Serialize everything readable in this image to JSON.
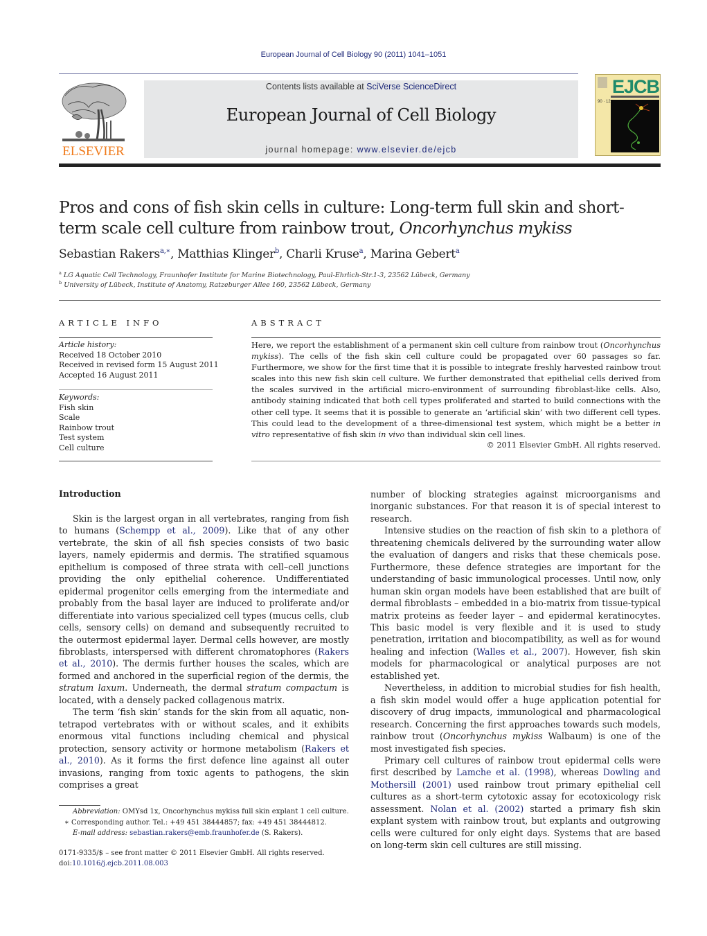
{
  "running_head": "European Journal of Cell Biology 90 (2011) 1041–1051",
  "masthead": {
    "publisher_logo_text": "ELSEVIER",
    "contents_prefix": "Contents lists available at ",
    "contents_link": "SciVerse ScienceDirect",
    "journal_title": "European Journal of Cell Biology",
    "homepage_prefix": "journal homepage: ",
    "homepage_link": "www.elsevier.de/ejcb",
    "cover_logo": "EJCB",
    "cover_volume": "90 · 12"
  },
  "colors": {
    "link": "#1f2a7a",
    "elsevier_orange": "#f07a1a",
    "masthead_bg": "#e6e7e8",
    "cover_bg": "#f4e7a8",
    "cover_logo": "#1f8a6a"
  },
  "article": {
    "title_part1": "Pros and cons of fish skin cells in culture: Long-term full skin and short-term scale cell culture from rainbow trout, ",
    "title_italic": "Oncorhynchus mykiss",
    "authors": [
      {
        "name": "Sebastian Rakers",
        "sup": "a,∗",
        "sep": ", "
      },
      {
        "name": "Matthias Klinger",
        "sup": "b",
        "sep": ", "
      },
      {
        "name": "Charli Kruse",
        "sup": "a",
        "sep": ", "
      },
      {
        "name": "Marina Gebert",
        "sup": "a",
        "sep": ""
      }
    ],
    "affiliations": [
      {
        "key": "a",
        "text": "LG Aquatic Cell Technology, Fraunhofer Institute for Marine Biotechnology, Paul-Ehrlich-Str.1-3, 23562 Lübeck, Germany"
      },
      {
        "key": "b",
        "text": "University of Lübeck, Institute of Anatomy, Ratzeburger Allee 160, 23562 Lübeck, Germany"
      }
    ]
  },
  "article_info": {
    "heading": "ARTICLE INFO",
    "history_label": "Article history:",
    "history": [
      "Received 18 October 2010",
      "Received in revised form 15 August 2011",
      "Accepted 16 August 2011"
    ],
    "keywords_label": "Keywords:",
    "keywords": [
      "Fish skin",
      "Scale",
      "Rainbow trout",
      "Test system",
      "Cell culture"
    ]
  },
  "abstract": {
    "heading": "ABSTRACT",
    "s1": "Here, we report the establishment of a permanent skin cell culture from rainbow trout (",
    "s1_italic": "Oncorhynchus mykiss",
    "s2": "). The cells of the fish skin cell culture could be propagated over 60 passages so far. Furthermore, we show for the first time that it is possible to integrate freshly harvested rainbow trout scales into this new fish skin cell culture. We further demonstrated that epithelial cells derived from the scales survived in the artificial micro-environment of surrounding fibroblast-like cells. Also, antibody staining indicated that both cell types proliferated and started to build connections with the other cell type. It seems that it is possible to generate an ‘artificial skin’ with two different cell types. This could lead to the development of a three-dimensional test system, which might be a better ",
    "s2_italic": "in vitro",
    "s3": " representative of fish skin ",
    "s3_italic": "in vivo",
    "s4": " than individual skin cell lines.",
    "copyright": "© 2011 Elsevier GmbH. All rights reserved."
  },
  "introduction": {
    "heading": "Introduction",
    "p1_a": "Skin is the largest organ in all vertebrates, ranging from fish to humans (",
    "p1_ref1": "Schempp et al., 2009",
    "p1_b": "). Like that of any other vertebrate, the skin of all fish species consists of two basic layers, namely epidermis and dermis. The stratified squamous epithelium is composed of three strata with cell–cell junctions providing the only epithelial coherence. Undifferentiated epidermal progenitor cells emerging from the intermediate and probably from the basal layer are induced to proliferate and/or differentiate into various specialized cell types (mucus cells, club cells, sensory cells) on demand and subsequently recruited to the outermost epidermal layer. Dermal cells however, are mostly fibroblasts, interspersed with different chromatophores (",
    "p1_ref2": "Rakers et al., 2010",
    "p1_c": "). The dermis further houses the scales, which are formed and anchored in the superficial region of the dermis, the ",
    "p1_it1": "stratum laxum",
    "p1_d": ". Underneath, the dermal ",
    "p1_it2": "stratum compactum",
    "p1_e": " is located, with a densely packed collagenous matrix.",
    "p2_a": "The term ‘fish skin’ stands for the skin from all aquatic, non-tetrapod vertebrates with or without scales, and it exhibits enormous vital functions including chemical and physical protection, sensory activity or hormone metabolism (",
    "p2_ref": "Rakers et al., 2010",
    "p2_b": "). As it forms the first defence line against all outer invasions, ranging from toxic agents to pathogens, the skin comprises a great",
    "p2_cont": "number of blocking strategies against microorganisms and inorganic substances. For that reason it is of special interest to research.",
    "p3_a": "Intensive studies on the reaction of fish skin to a plethora of threatening chemicals delivered by the surrounding water allow the evaluation of dangers and risks that these chemicals pose. Furthermore, these defence strategies are important for the understanding of basic immunological processes. Until now, only human skin organ models have been established that are built of dermal fibroblasts – embedded in a bio-matrix from tissue-typical matrix proteins as feeder layer – and epidermal keratinocytes. This basic model is very flexible and it is used to study penetration, irritation and biocompatibility, as well as for wound healing and infection (",
    "p3_ref": "Walles et al., 2007",
    "p3_b": "). However, fish skin models for pharmacological or analytical purposes are not established yet.",
    "p4_a": "Nevertheless, in addition to microbial studies for fish health, a fish skin model would offer a huge application potential for discovery of drug impacts, immunological and pharmacological research. Concerning the first approaches towards such models, rainbow trout (",
    "p4_it": "Oncorhynchus mykiss",
    "p4_b": " Walbaum) is one of the most investigated fish species.",
    "p5_a": "Primary cell cultures of rainbow trout epidermal cells were first described by ",
    "p5_ref1": "Lamche et al. (1998)",
    "p5_b": ", whereas ",
    "p5_ref2": "Dowling and Mothersill (2001)",
    "p5_c": " used rainbow trout primary epithelial cell cultures as a short-term cytotoxic assay for ecotoxicology risk assessment. ",
    "p5_ref3": "Nolan et al. (2002)",
    "p5_d": " started a primary fish skin explant system with rainbow trout, but explants and outgrowing cells were cultured for only eight days. Systems that are based on long-term skin cell cultures are still missing."
  },
  "footnotes": {
    "abbrev_label": "Abbreviation:",
    "abbrev_text": " OMYsd 1x, Oncorhynchus mykiss full skin explant 1 cell culture.",
    "corr_mark": "∗",
    "corr_text": " Corresponding author. Tel.: +49 451 38444857; fax: +49 451 38444812.",
    "email_label": "E-mail address:",
    "email": "sebastian.rakers@emb.fraunhofer.de",
    "email_suffix": " (S. Rakers).",
    "front_matter": "0171-9335/$ – see front matter © 2011 Elsevier GmbH. All rights reserved.",
    "doi_label": "doi:",
    "doi": "10.1016/j.ejcb.2011.08.003"
  }
}
